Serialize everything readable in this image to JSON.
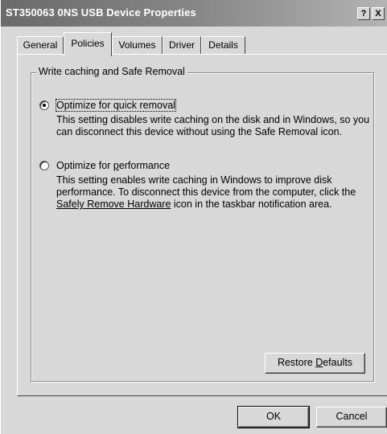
{
  "window": {
    "title": "ST350063 0NS USB Device Properties",
    "help_button": "?",
    "close_button": "X"
  },
  "tabs": [
    {
      "label": "General",
      "active": false
    },
    {
      "label": "Policies",
      "active": true
    },
    {
      "label": "Volumes",
      "active": false
    },
    {
      "label": "Driver",
      "active": false
    },
    {
      "label": "Details",
      "active": false
    }
  ],
  "group": {
    "title": "Write caching and Safe Removal",
    "option_quick": {
      "label": "Optimize for quick removal",
      "selected": true,
      "description": "This setting disables write caching on the disk and in Windows, so you can disconnect this device without using the Safe Removal icon."
    },
    "option_performance": {
      "label_pre": "Optimize for ",
      "label_key": "p",
      "label_post": "erformance",
      "selected": false,
      "description_pre": "This setting enables write caching in Windows to improve disk performance. To disconnect this device from the computer, click the ",
      "description_link": "Safely Remove Hardware",
      "description_post": " icon in the taskbar notification area."
    }
  },
  "buttons": {
    "restore_pre": "Restore ",
    "restore_key": "D",
    "restore_post": "efaults",
    "ok": "OK",
    "cancel": "Cancel"
  },
  "colors": {
    "dialog_background": "#d8d8d8",
    "title_text": "#ffffff"
  }
}
